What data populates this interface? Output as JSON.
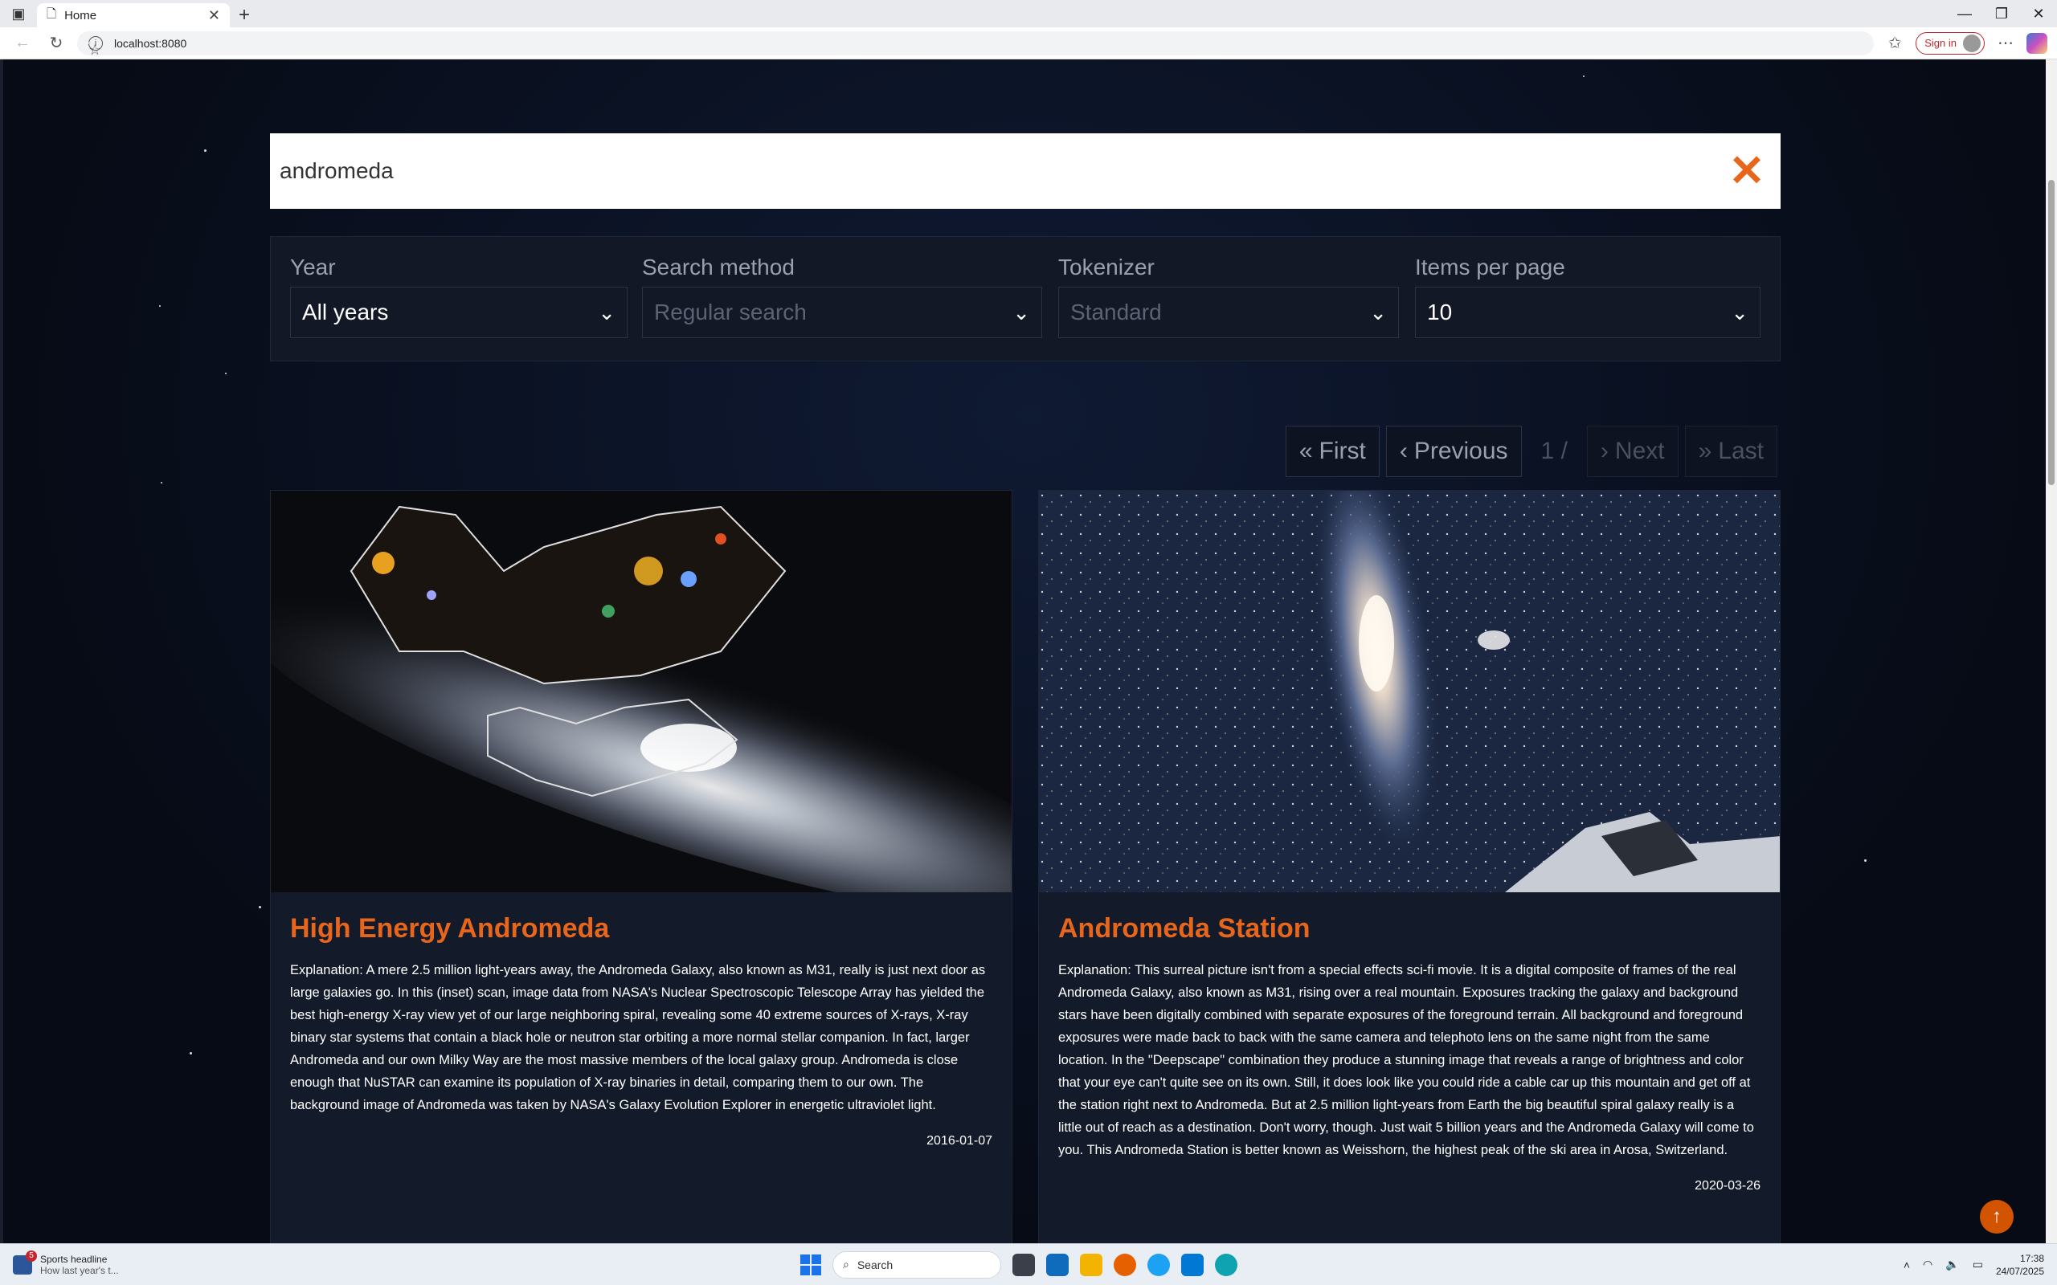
{
  "browser": {
    "tab_title": "Home",
    "url": "localhost:8080",
    "sign_in": "Sign in"
  },
  "search": {
    "query": "andromeda"
  },
  "filters": [
    {
      "label": "Year",
      "value": "All years"
    },
    {
      "label": "Search method",
      "value": "Regular search"
    },
    {
      "label": "Tokenizer",
      "value": "Standard"
    },
    {
      "label": "Items per page",
      "value": "10"
    }
  ],
  "pager": {
    "first": "First",
    "previous": "Previous",
    "page": "1 /",
    "next": "Next",
    "last": "Last"
  },
  "results": [
    {
      "title": "High Energy Andromeda",
      "explanation": "Explanation: A mere 2.5 million light-years away, the Andromeda Galaxy, also known as M31, really is just next door as large galaxies go. In this (inset) scan, image data from NASA's Nuclear Spectroscopic Telescope Array has yielded the best high-energy X-ray view yet of our large neighboring spiral, revealing some 40 extreme sources of X-rays, X-ray binary star systems that contain a black hole or neutron star orbiting a more normal stellar companion. In fact, larger Andromeda and our own Milky Way are the most massive members of the local galaxy group. Andromeda is close enough that NuSTAR can examine its population of X-ray binaries in detail, comparing them to our own. The background image of Andromeda was taken by NASA's Galaxy Evolution Explorer in energetic ultraviolet light.",
      "date": "2016-01-07"
    },
    {
      "title": "Andromeda Station",
      "explanation": "Explanation: This surreal picture isn't from a special effects sci-fi movie. It is a digital composite of frames of the real Andromeda Galaxy, also known as M31, rising over a real mountain. Exposures tracking the galaxy and background stars have been digitally combined with separate exposures of the foreground terrain. All background and foreground exposures were made back to back with the same camera and telephoto lens on the same night from the same location. In the \"Deepscape\" combination they produce a stunning image that reveals a range of brightness and color that your eye can't quite see on its own. Still, it does look like you could ride a cable car up this mountain and get off at the station right next to Andromeda. But at 2.5 million light-years from Earth the big beautiful spiral galaxy really is a little out of reach as a destination. Don't worry, though. Just wait 5 billion years and the Andromeda Galaxy will come to you. This Andromeda Station is better known as Weisshorn, the highest peak of the ski area in Arosa, Switzerland.",
      "date": "2020-03-26"
    }
  ],
  "taskbar": {
    "news_title": "Sports headline",
    "news_sub": "How last year's t...",
    "news_badge": "5",
    "search_placeholder": "Search",
    "time": "17:38",
    "date": "24/07/2025"
  },
  "colors": {
    "accent": "#e8661c",
    "background": "#0a0e1a",
    "card": "#131a29"
  }
}
